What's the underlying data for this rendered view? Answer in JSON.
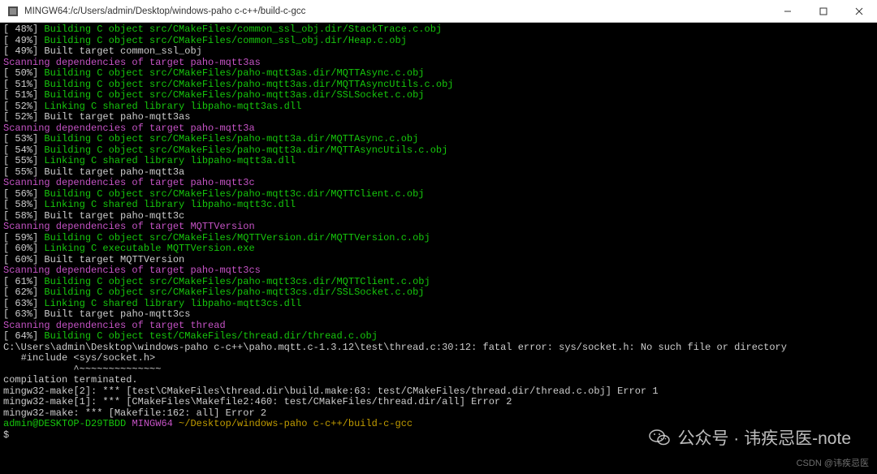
{
  "window": {
    "title": "MINGW64:/c/Users/admin/Desktop/windows-paho c-c++/build-c-gcc"
  },
  "lines": [
    {
      "pct": "48%",
      "kind": "build",
      "text": "Building C object src/CMakeFiles/common_ssl_obj.dir/StackTrace.c.obj"
    },
    {
      "pct": "49%",
      "kind": "build",
      "text": "Building C object src/CMakeFiles/common_ssl_obj.dir/Heap.c.obj"
    },
    {
      "pct": "49%",
      "kind": "done",
      "text": "Built target common_ssl_obj"
    },
    {
      "kind": "scan",
      "text": "Scanning dependencies of target paho-mqtt3as"
    },
    {
      "pct": "50%",
      "kind": "build",
      "text": "Building C object src/CMakeFiles/paho-mqtt3as.dir/MQTTAsync.c.obj"
    },
    {
      "pct": "51%",
      "kind": "build",
      "text": "Building C object src/CMakeFiles/paho-mqtt3as.dir/MQTTAsyncUtils.c.obj"
    },
    {
      "pct": "51%",
      "kind": "build",
      "text": "Building C object src/CMakeFiles/paho-mqtt3as.dir/SSLSocket.c.obj"
    },
    {
      "pct": "52%",
      "kind": "link",
      "text": "Linking C shared library libpaho-mqtt3as.dll"
    },
    {
      "pct": "52%",
      "kind": "done",
      "text": "Built target paho-mqtt3as"
    },
    {
      "kind": "scan",
      "text": "Scanning dependencies of target paho-mqtt3a"
    },
    {
      "pct": "53%",
      "kind": "build",
      "text": "Building C object src/CMakeFiles/paho-mqtt3a.dir/MQTTAsync.c.obj"
    },
    {
      "pct": "54%",
      "kind": "build",
      "text": "Building C object src/CMakeFiles/paho-mqtt3a.dir/MQTTAsyncUtils.c.obj"
    },
    {
      "pct": "55%",
      "kind": "link",
      "text": "Linking C shared library libpaho-mqtt3a.dll"
    },
    {
      "pct": "55%",
      "kind": "done",
      "text": "Built target paho-mqtt3a"
    },
    {
      "kind": "scan",
      "text": "Scanning dependencies of target paho-mqtt3c"
    },
    {
      "pct": "56%",
      "kind": "build",
      "text": "Building C object src/CMakeFiles/paho-mqtt3c.dir/MQTTClient.c.obj"
    },
    {
      "pct": "58%",
      "kind": "link",
      "text": "Linking C shared library libpaho-mqtt3c.dll"
    },
    {
      "pct": "58%",
      "kind": "done",
      "text": "Built target paho-mqtt3c"
    },
    {
      "kind": "scan",
      "text": "Scanning dependencies of target MQTTVersion"
    },
    {
      "pct": "59%",
      "kind": "build",
      "text": "Building C object src/CMakeFiles/MQTTVersion.dir/MQTTVersion.c.obj"
    },
    {
      "pct": "60%",
      "kind": "link",
      "text": "Linking C executable MQTTVersion.exe"
    },
    {
      "pct": "60%",
      "kind": "done",
      "text": "Built target MQTTVersion"
    },
    {
      "kind": "scan",
      "text": "Scanning dependencies of target paho-mqtt3cs"
    },
    {
      "pct": "61%",
      "kind": "build",
      "text": "Building C object src/CMakeFiles/paho-mqtt3cs.dir/MQTTClient.c.obj"
    },
    {
      "pct": "62%",
      "kind": "build",
      "text": "Building C object src/CMakeFiles/paho-mqtt3cs.dir/SSLSocket.c.obj"
    },
    {
      "pct": "63%",
      "kind": "link",
      "text": "Linking C shared library libpaho-mqtt3cs.dll"
    },
    {
      "pct": "63%",
      "kind": "done",
      "text": "Built target paho-mqtt3cs"
    },
    {
      "kind": "scan",
      "text": "Scanning dependencies of target thread"
    },
    {
      "pct": "64%",
      "kind": "build",
      "text": "Building C object test/CMakeFiles/thread.dir/thread.c.obj"
    }
  ],
  "error": {
    "path": "C:\\Users\\admin\\Desktop\\windows-paho c-c++\\paho.mqtt.c-1.3.12\\test\\thread.c:30:12: fatal error: sys/socket.h: No such file or directory",
    "include": "   #include <sys/socket.h>",
    "tildes": "            ^~~~~~~~~~~~~~~",
    "term": "compilation terminated.",
    "m1": "mingw32-make[2]: *** [test\\CMakeFiles\\thread.dir\\build.make:63: test/CMakeFiles/thread.dir/thread.c.obj] Error 1",
    "m2": "mingw32-make[1]: *** [CMakeFiles\\Makefile2:460: test/CMakeFiles/thread.dir/all] Error 2",
    "m3": "mingw32-make: *** [Makefile:162: all] Error 2"
  },
  "prompt": {
    "user": "admin@DESKTOP-D29TBDD",
    "shell": "MINGW64",
    "cwd": "~/Desktop/windows-paho c-c++/build-c-gcc",
    "dollar": "$"
  },
  "watermark": {
    "text": "公众号 · 讳疾忌医-note",
    "csdn": "CSDN @讳疾忌医"
  }
}
